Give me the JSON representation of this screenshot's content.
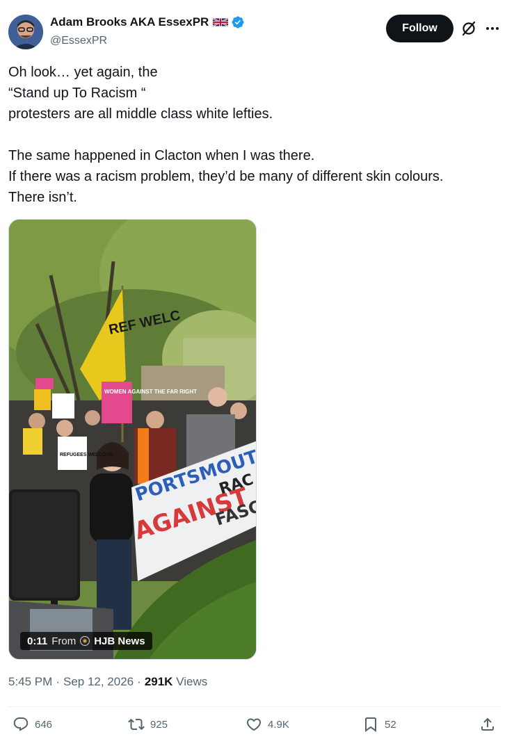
{
  "author": {
    "display_name": "Adam Brooks AKA EssexPR",
    "handle": "@EssexPR"
  },
  "header": {
    "follow_label": "Follow"
  },
  "tweet": {
    "text": "Oh look… yet again, the\n“Stand up To Racism “\nprotesters are all middle class white lefties.\n\nThe same happened in Clacton when I was there.\nIf there was a racism problem, they’d be many of different skin colours.\nThere isn’t."
  },
  "media": {
    "duration": "0:11",
    "from_label": "From",
    "source": "HJB News",
    "scene_text": {
      "flag": "REF WELC",
      "sign_women": "WOMEN AGAINST THE FAR RIGHT",
      "sign_refugees": "REFUGEES WELCOME",
      "banner_line1": "PORTSMOUTH",
      "banner_line2": "AGAINST",
      "banner_line3": "RAC",
      "banner_line4": "FASC"
    }
  },
  "meta": {
    "time": "5:45 PM",
    "sep1": "·",
    "date": "Sep 12, 2026",
    "sep2": "·",
    "views_count": "291K",
    "views_label": "Views"
  },
  "actions": {
    "replies": "646",
    "reposts": "925",
    "likes": "4.9K",
    "bookmarks": "52"
  },
  "colors": {
    "text": "#0f1419",
    "secondary": "#536471",
    "verified": "#1d9bf0",
    "follow_bg": "#0f1419"
  }
}
